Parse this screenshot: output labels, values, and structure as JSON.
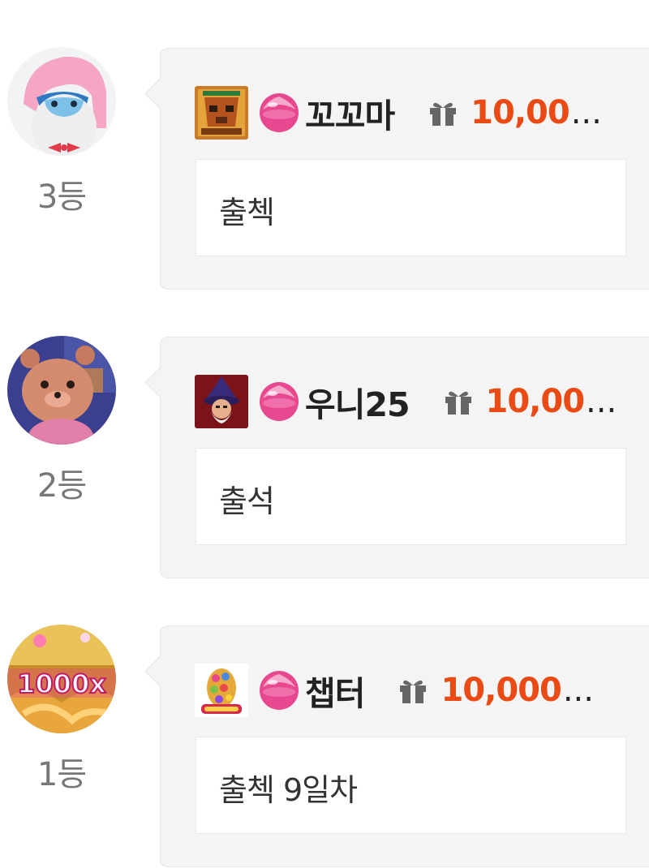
{
  "entries": [
    {
      "rank": "3등",
      "nickname": "꼬꼬마",
      "amount": "10,00",
      "message": "출첵",
      "avatar_icon": "pink-hair-shark-avatar",
      "game_icon": "aztec-mask-game-icon"
    },
    {
      "rank": "2등",
      "nickname": "우니25",
      "amount": "10,00",
      "message": "출석",
      "avatar_icon": "brown-quokka-avatar",
      "game_icon": "wizard-game-icon"
    },
    {
      "rank": "1등",
      "nickname": "챕터",
      "amount": "10,000",
      "message": "출첵 9일차",
      "avatar_icon": "1000x-candy-avatar",
      "game_icon": "scatter-egg-game-icon"
    }
  ],
  "ellipsis": "...",
  "colors": {
    "amount": "#ea4a13",
    "bubble_bg": "#f4f4f4",
    "rank_text": "#777777",
    "gem": "#e8488f"
  }
}
